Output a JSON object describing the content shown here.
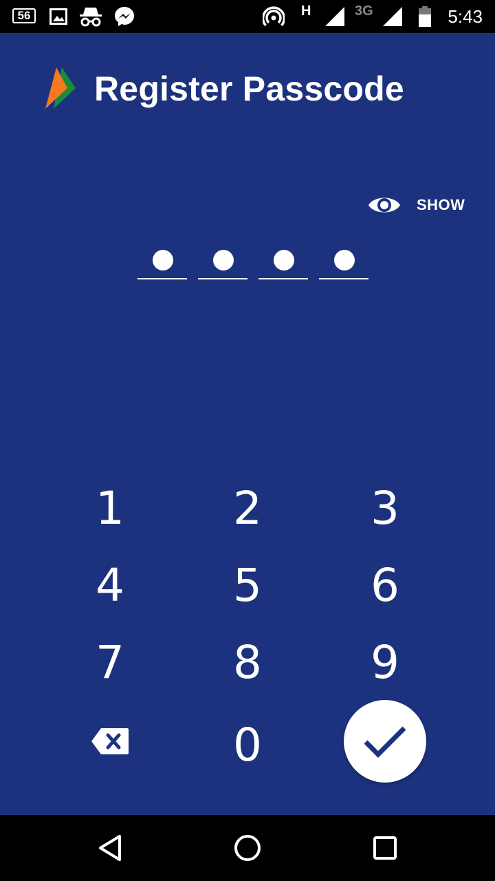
{
  "status_bar": {
    "badge_text": "56",
    "network_h": "H",
    "network_3g": "3G",
    "time": "5:43",
    "icons": [
      "notification-badge-icon",
      "image-icon",
      "incognito-icon",
      "messenger-icon",
      "hotspot-icon",
      "signal-icon",
      "signal-icon",
      "battery-icon"
    ]
  },
  "header": {
    "logo": "bhim-logo-icon",
    "title": "Register Passcode"
  },
  "passcode": {
    "show_label": "SHOW",
    "show_icon": "eye-icon",
    "digits_entered": 4,
    "digits_total": 4
  },
  "keypad": {
    "keys": [
      "1",
      "2",
      "3",
      "4",
      "5",
      "6",
      "7",
      "8",
      "9",
      "0"
    ],
    "backspace_icon": "backspace-icon",
    "submit_icon": "check-icon"
  },
  "nav_bar": {
    "icons": [
      "back-triangle-icon",
      "home-circle-icon",
      "recents-square-icon"
    ]
  },
  "colors": {
    "background": "#1d327e",
    "accent_orange": "#f47920",
    "accent_green": "#1b8a3a",
    "foreground": "#ffffff"
  }
}
